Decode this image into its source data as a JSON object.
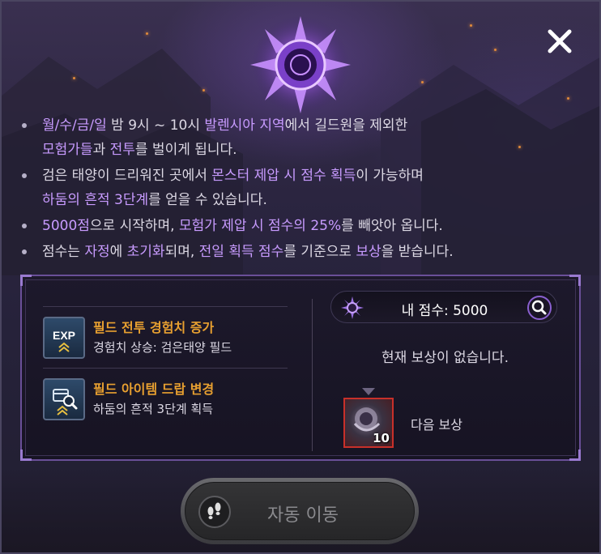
{
  "close": {
    "icon": "close-icon"
  },
  "info": [
    {
      "parts": [
        {
          "t": "월/수/금/일",
          "h": true
        },
        {
          "t": " 밤 9시 ~ 10시 ",
          "h": false
        },
        {
          "t": "발렌시아 지역",
          "h": true
        },
        {
          "t": "에서 길드원을 제외한",
          "h": false
        }
      ]
    },
    {
      "parts": [
        {
          "t": "모험가들",
          "h": true
        },
        {
          "t": "과 ",
          "h": false
        },
        {
          "t": "전투",
          "h": true
        },
        {
          "t": "를 벌이게 됩니다.",
          "h": false
        }
      ],
      "cont": true
    },
    {
      "parts": [
        {
          "t": "검은 태양이 드리워진 곳에서 ",
          "h": false
        },
        {
          "t": "몬스터 제압 시 점수 획득",
          "h": true
        },
        {
          "t": "이 가능하며",
          "h": false
        }
      ]
    },
    {
      "parts": [
        {
          "t": "하둠의 흔적 3단계",
          "h": true
        },
        {
          "t": "를 얻을 수 있습니다.",
          "h": false
        }
      ],
      "cont": true
    },
    {
      "parts": [
        {
          "t": "5000점",
          "h": true
        },
        {
          "t": "으로 시작하며, ",
          "h": false
        },
        {
          "t": "모험가 제압 시 점수의 25%",
          "h": true
        },
        {
          "t": "를 빼앗아 옵니다.",
          "h": false
        }
      ]
    },
    {
      "parts": [
        {
          "t": "점수는 ",
          "h": false
        },
        {
          "t": "자정",
          "h": true
        },
        {
          "t": "에 ",
          "h": false
        },
        {
          "t": "초기화",
          "h": true
        },
        {
          "t": "되며, ",
          "h": false
        },
        {
          "t": "전일 획득 점수",
          "h": true
        },
        {
          "t": "를 기준으로 ",
          "h": false
        },
        {
          "t": "보상",
          "h": true
        },
        {
          "t": "을 받습니다.",
          "h": false
        }
      ]
    }
  ],
  "buffs": [
    {
      "title": "필드 전투 경험치 증가",
      "desc": "경험치 상승: 검은태양 필드",
      "icon": "exp-icon",
      "icon_text": "EXP"
    },
    {
      "title": "필드 아이템 드랍 변경",
      "desc": "하둠의 흔적 3단계 획득",
      "icon": "item-drop-icon"
    }
  ],
  "score": {
    "label": "내 점수: 5000"
  },
  "reward": {
    "current": "현재 보상이 없습니다.",
    "next_label": "다음 보상",
    "next_count": "10"
  },
  "auto_move": {
    "label": "자동 이동"
  },
  "colors": {
    "highlight": "#c89bff",
    "buff_title": "#e8a030",
    "accent": "#8a60d0"
  }
}
